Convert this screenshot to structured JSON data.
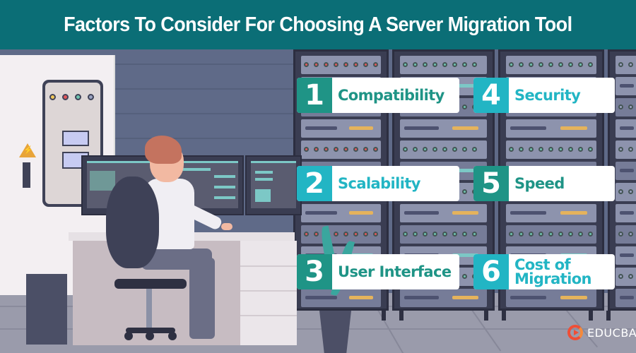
{
  "header": {
    "title": "Factors To Consider For Choosing A Server Migration Tool"
  },
  "factors": [
    {
      "number": "1",
      "label": "Compatibility",
      "theme": "teal"
    },
    {
      "number": "2",
      "label": "Scalability",
      "theme": "cyan"
    },
    {
      "number": "3",
      "label": "User Interface",
      "theme": "teal"
    },
    {
      "number": "4",
      "label": "Security",
      "theme": "cyan"
    },
    {
      "number": "5",
      "label": "Speed",
      "theme": "teal"
    },
    {
      "number": "6",
      "label": "Cost of Migration",
      "theme": "cyan"
    }
  ],
  "colors": {
    "header_bg": "#0b6e76",
    "teal": "#1f9486",
    "cyan": "#22b5c4",
    "card_bg": "#ffffff",
    "logo_accent": "#ef4e36"
  },
  "logo": {
    "icon": "educba-play-icon",
    "text": "EDUCBA"
  },
  "illustration": {
    "description": "Man working at desk with dual monitors in a server room"
  }
}
